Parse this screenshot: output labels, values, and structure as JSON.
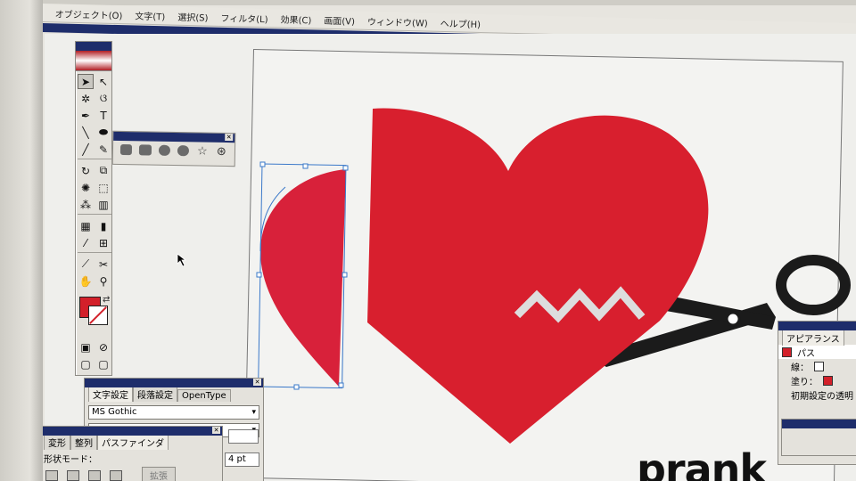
{
  "menu": {
    "items": [
      "オブジェクト(O)",
      "文字(T)",
      "選択(S)",
      "フィルタ(L)",
      "効果(C)",
      "画面(V)",
      "ウィンドウ(W)",
      "ヘルプ(H)"
    ]
  },
  "toolbox": {
    "fill_color": "#d3202a",
    "stroke_color": "#ffffff"
  },
  "char_panel": {
    "tabs": [
      "文字設定",
      "段落設定",
      "OpenType"
    ],
    "font": "MS Gothic"
  },
  "pathfinder_panel": {
    "tabs": [
      "変形",
      "整列",
      "パスファインダ"
    ],
    "shape_mode_label": "形状モード：",
    "expand_label": "拡張"
  },
  "pt_value": "4 pt",
  "appearance_panel": {
    "tab": "アピアランス",
    "item_label": "パス",
    "stroke_label": "線：",
    "fill_label": "塗り：",
    "reset_label": "初期設定の透明"
  },
  "canvas": {
    "heart_color": "#d81f2e",
    "accent_color": "#1e2d6b",
    "headline_text": "prank"
  }
}
